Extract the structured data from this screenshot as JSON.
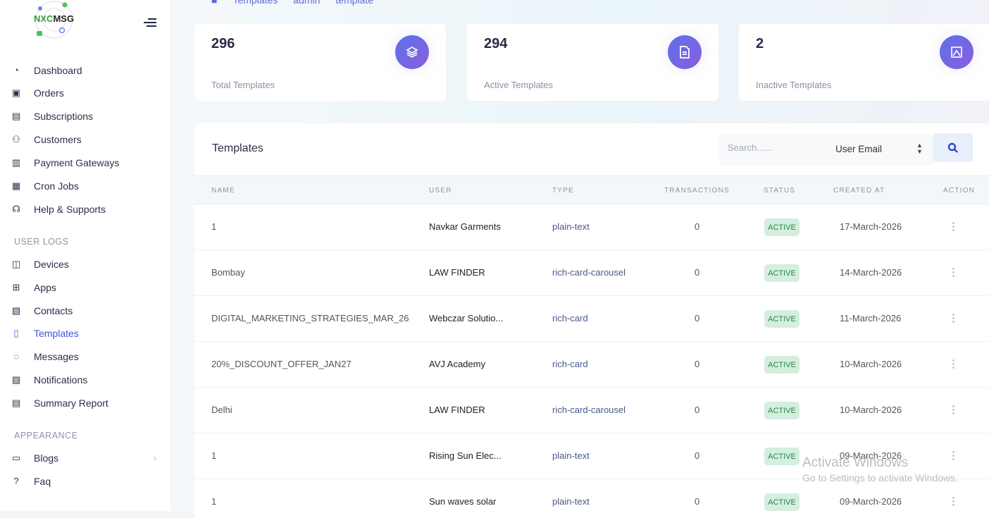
{
  "brand": {
    "logo_text": "NXCMSG"
  },
  "breadcrumb": [
    "Templates",
    "admin",
    "template"
  ],
  "sidebar": {
    "main": [
      {
        "label": "Dashboard",
        "icon": "gauge-icon"
      },
      {
        "label": "Orders",
        "icon": "boxes-icon"
      },
      {
        "label": "Subscriptions",
        "icon": "receipt-icon"
      },
      {
        "label": "Customers",
        "icon": "users-icon"
      },
      {
        "label": "Payment Gateways",
        "icon": "bank-icon"
      },
      {
        "label": "Cron Jobs",
        "icon": "calendar-clock-icon"
      },
      {
        "label": "Help & Supports",
        "icon": "headset-icon"
      }
    ],
    "user_logs_title": "USER LOGS",
    "user_logs": [
      {
        "label": "Devices",
        "icon": "devices-icon"
      },
      {
        "label": "Apps",
        "icon": "grid-icon"
      },
      {
        "label": "Contacts",
        "icon": "contact-book-icon"
      },
      {
        "label": "Templates",
        "icon": "file-icon"
      },
      {
        "label": "Messages",
        "icon": "chat-icon"
      },
      {
        "label": "Notifications",
        "icon": "bell-icon"
      },
      {
        "label": "Summary Report",
        "icon": "report-icon"
      }
    ],
    "appearance_title": "APPEARANCE",
    "appearance": [
      {
        "label": "Blogs",
        "icon": "blog-icon"
      },
      {
        "label": "Faq",
        "icon": "faq-icon"
      }
    ]
  },
  "stats": [
    {
      "value": "296",
      "label": "Total Templates",
      "icon": "layers-icon"
    },
    {
      "value": "294",
      "label": "Active Templates",
      "icon": "file-text-icon"
    },
    {
      "value": "2",
      "label": "Inactive Templates",
      "icon": "image-off-icon"
    }
  ],
  "panel": {
    "title": "Templates",
    "search_placeholder": "Search......",
    "search_field": "User Email",
    "columns": [
      "NAME",
      "USER",
      "TYPE",
      "TRANSACTIONS",
      "STATUS",
      "CREATED AT",
      "ACTION"
    ],
    "rows": [
      {
        "name": "1",
        "user": "Navkar Garments",
        "type": "plain-text",
        "transactions": "0",
        "status": "ACTIVE",
        "created": "17-March-2026"
      },
      {
        "name": "Bombay",
        "user": "LAW FINDER",
        "type": "rich-card-carousel",
        "transactions": "0",
        "status": "ACTIVE",
        "created": "14-March-2026"
      },
      {
        "name": "DIGITAL_MARKETING_STRATEGIES_MAR_26",
        "user": "Webczar Solutio...",
        "type": "rich-card",
        "transactions": "0",
        "status": "ACTIVE",
        "created": "11-March-2026"
      },
      {
        "name": "20%_DISCOUNT_OFFER_JAN27",
        "user": "AVJ Academy",
        "type": "rich-card",
        "transactions": "0",
        "status": "ACTIVE",
        "created": "10-March-2026"
      },
      {
        "name": "Delhi",
        "user": "LAW FINDER",
        "type": "rich-card-carousel",
        "transactions": "0",
        "status": "ACTIVE",
        "created": "10-March-2026"
      },
      {
        "name": "1",
        "user": "Rising Sun Elec...",
        "type": "plain-text",
        "transactions": "0",
        "status": "ACTIVE",
        "created": "09-March-2026"
      },
      {
        "name": "1",
        "user": "Sun waves solar",
        "type": "plain-text",
        "transactions": "0",
        "status": "ACTIVE",
        "created": "09-March-2026"
      }
    ]
  },
  "watermark": {
    "title": "Activate Windows",
    "subtitle": "Go to Settings to activate Windows."
  }
}
